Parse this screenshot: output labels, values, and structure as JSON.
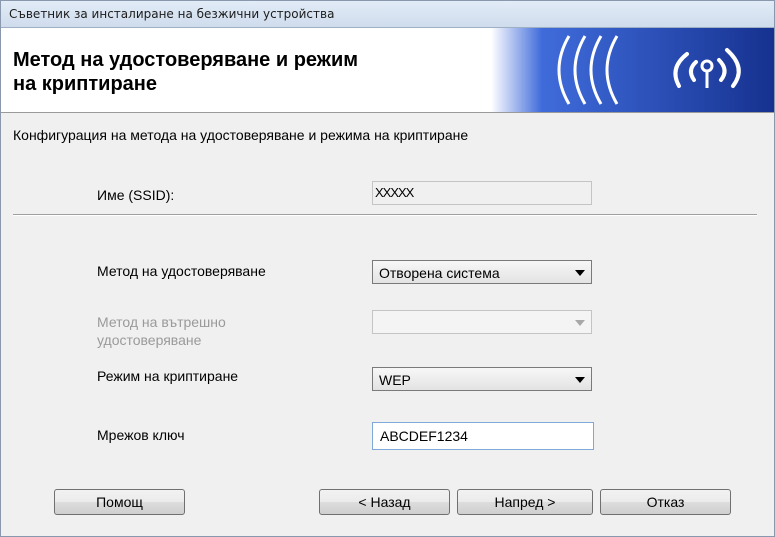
{
  "window": {
    "title": "Съветник за инсталиране на безжични устройства"
  },
  "header": {
    "title_line1": "Метод на удостоверяване и режим",
    "title_line2": "на криптиране"
  },
  "subtitle": "Конфигурация на метода на удостоверяване и режима на криптиране",
  "form": {
    "ssid_label": "Име (SSID):",
    "ssid_value": "XXXXX",
    "auth_method_label": "Метод на удостоверяване",
    "auth_method_value": "Отворена система",
    "inner_auth_label_line1": "Метод на вътрешно",
    "inner_auth_label_line2": "удостоверяване",
    "inner_auth_value": "",
    "encryption_label": "Режим на криптиране",
    "encryption_value": "WEP",
    "network_key_label": "Мрежов ключ",
    "network_key_value": "ABCDEF1234"
  },
  "buttons": {
    "help": "Помощ",
    "back": "< Назад",
    "next": "Напред >",
    "cancel": "Отказ"
  },
  "colors": {
    "banner_blue": "#1f3fa8",
    "window_bg": "#f0f0f0"
  }
}
